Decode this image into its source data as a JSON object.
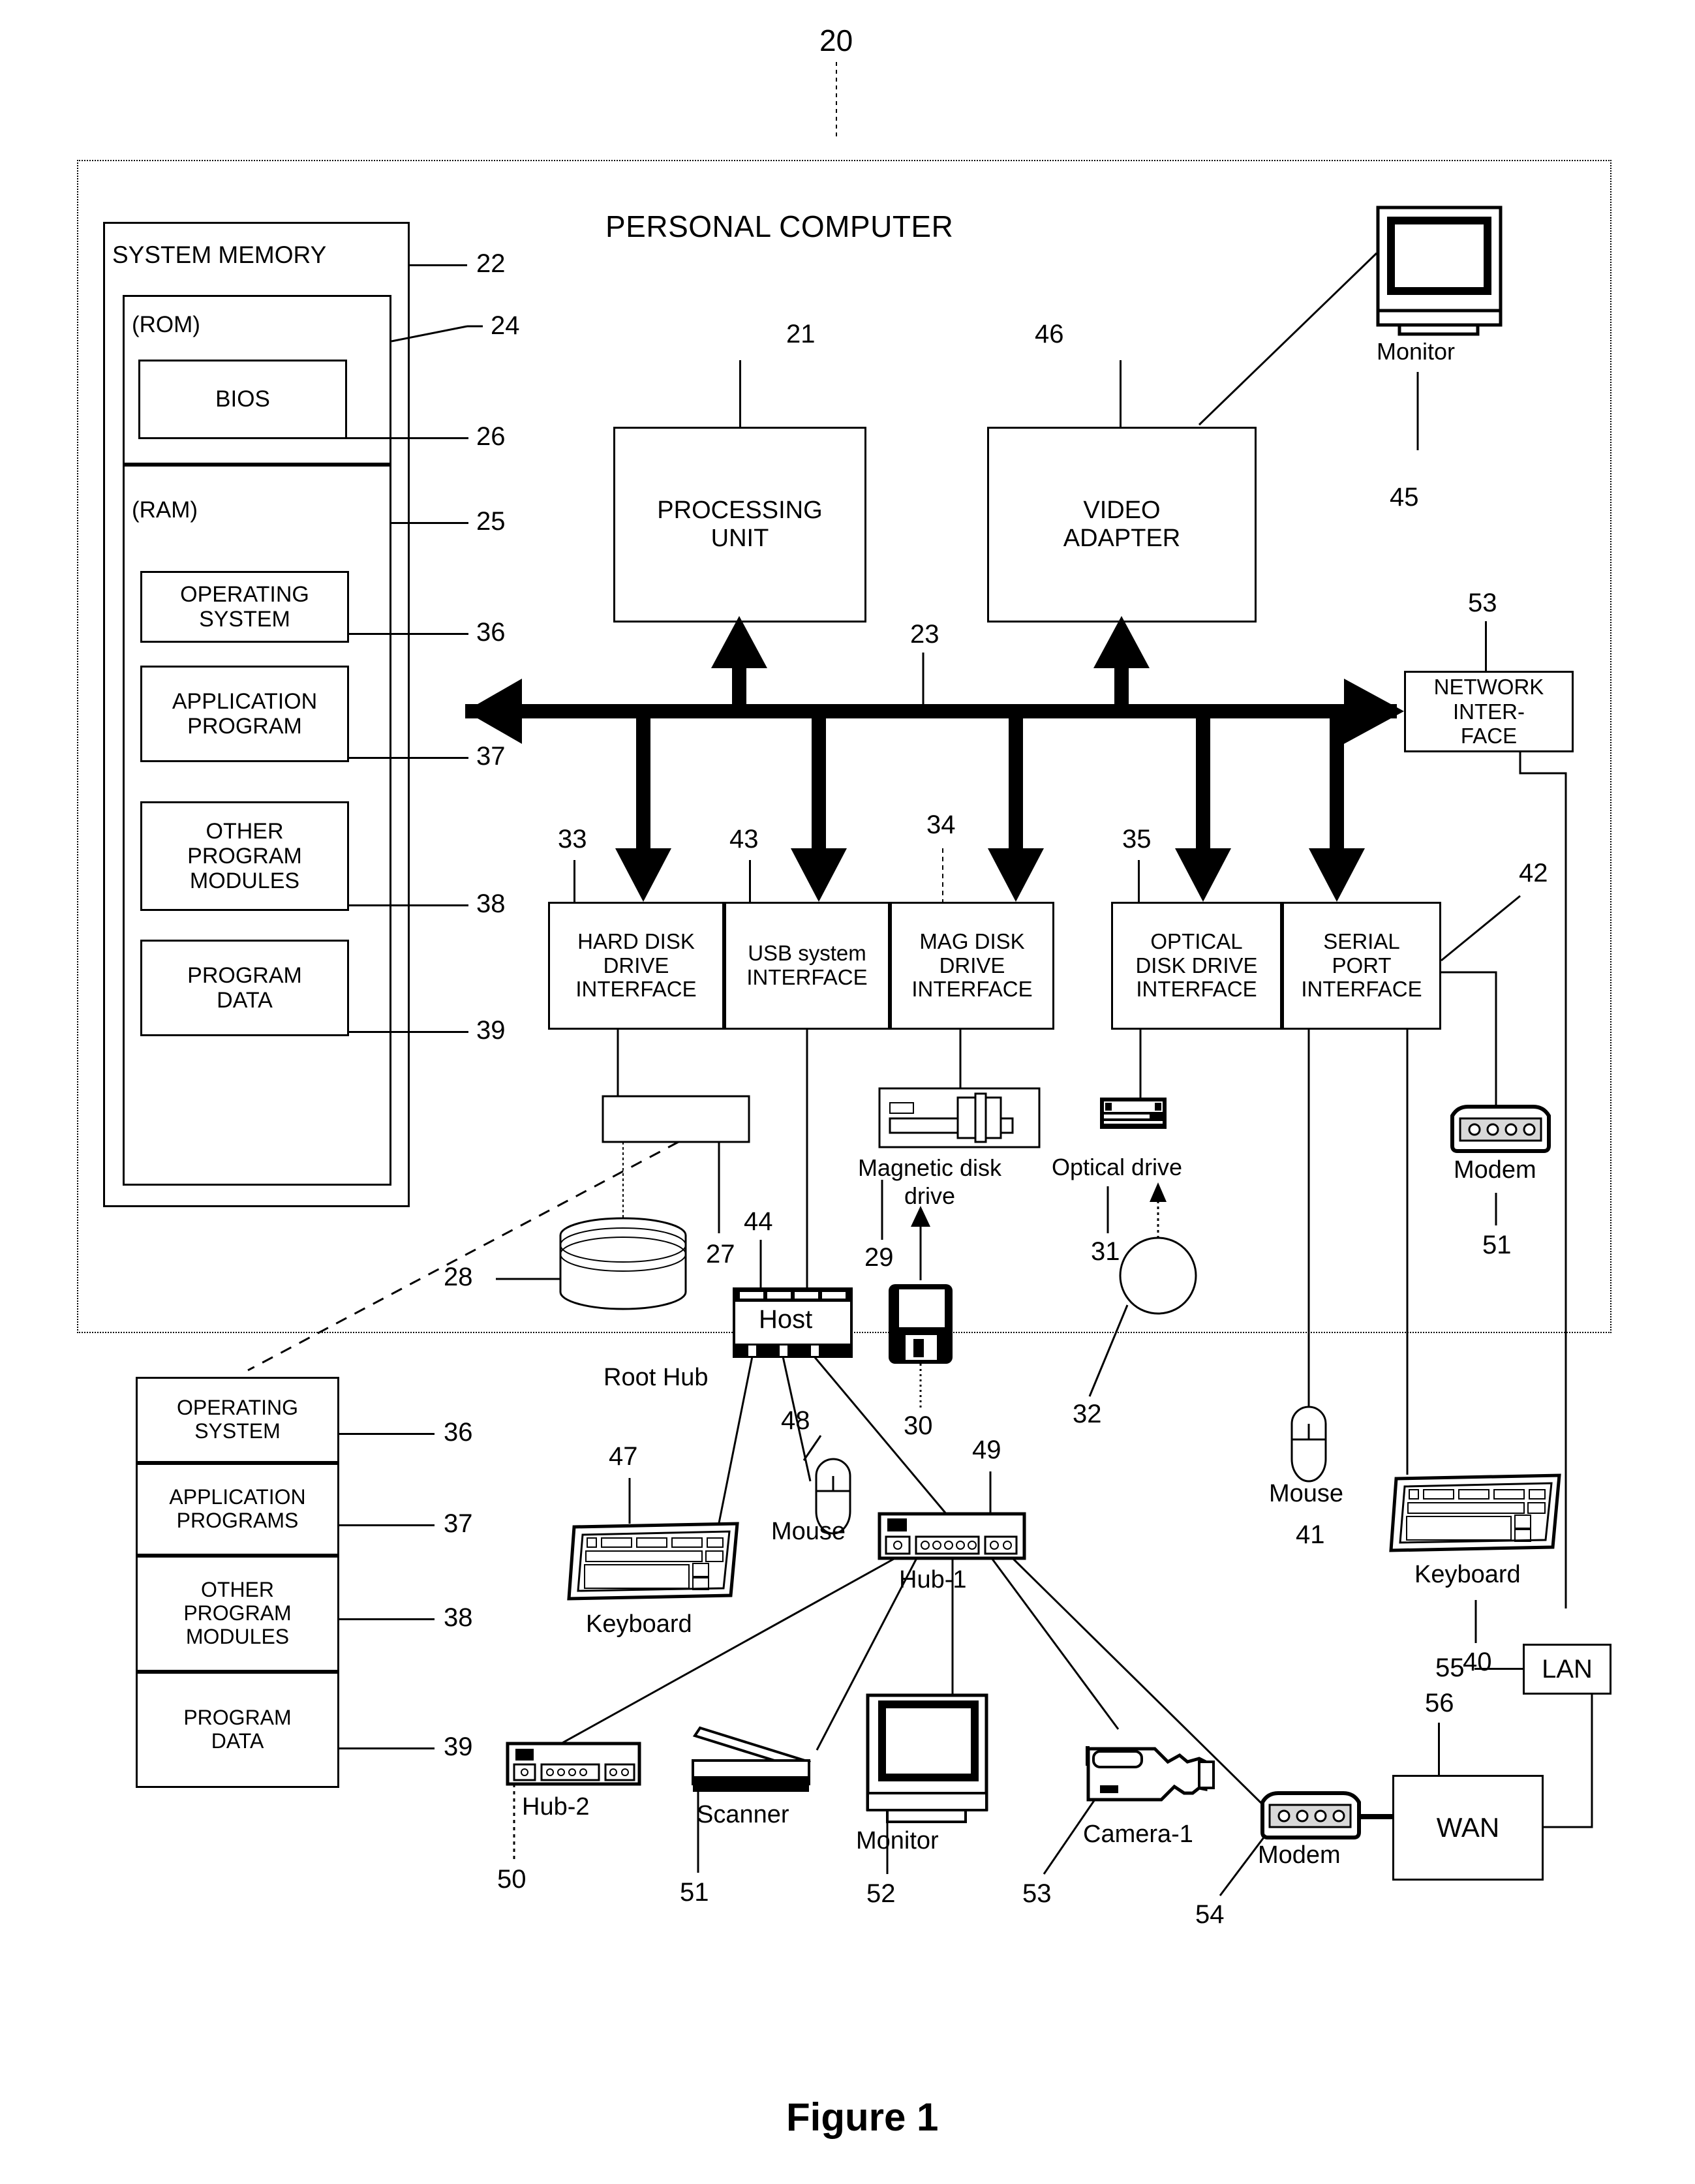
{
  "figure": {
    "caption": "Figure 1",
    "system_ref": "20",
    "title": "PERSONAL COMPUTER"
  },
  "system_memory": {
    "title": "SYSTEM MEMORY",
    "ref": "22",
    "rom": {
      "label": "(ROM)",
      "ref": "24"
    },
    "bios": {
      "label": "BIOS",
      "ref": "26"
    },
    "ram": {
      "label": "(RAM)",
      "ref": "25"
    },
    "items": [
      {
        "label": "OPERATING\nSYSTEM",
        "ref": "36"
      },
      {
        "label": "APPLICATION\nPROGRAM",
        "ref": "37"
      },
      {
        "label": "OTHER\nPROGRAM\nMODULES",
        "ref": "38"
      },
      {
        "label": "PROGRAM\nDATA",
        "ref": "39"
      }
    ]
  },
  "core": {
    "processing_unit": {
      "label": "PROCESSING\nUNIT",
      "ref": "21"
    },
    "video_adapter": {
      "label": "VIDEO\nADAPTER",
      "ref": "46"
    },
    "monitor": {
      "label": "Monitor",
      "ref": "45"
    },
    "network_interface": {
      "label": "NETWORK\nINTER-\nFACE",
      "ref": "53"
    },
    "system_bus": {
      "ref": "23"
    }
  },
  "interfaces": [
    {
      "label": "HARD DISK\nDRIVE\nINTERFACE",
      "ref": "33"
    },
    {
      "label": "USB system\nINTERFACE",
      "ref": "43"
    },
    {
      "label": "MAG DISK\nDRIVE\nINTERFACE",
      "ref": "34"
    },
    {
      "label": "OPTICAL\nDISK DRIVE\nINTERFACE",
      "ref": "35"
    },
    {
      "label": "SERIAL\nPORT\nINTERFACE",
      "ref": "42"
    }
  ],
  "drives": {
    "hard_disk_drive": {
      "ref": "27"
    },
    "hard_disk": {
      "ref": "28"
    },
    "magnetic_disk_drive": {
      "label": "Magnetic disk\ndrive",
      "ref": "29"
    },
    "magnetic_disk": {
      "ref": "30"
    },
    "optical_drive": {
      "label": "Optical drive",
      "ref": "31"
    },
    "optical_disk": {
      "ref": "32"
    }
  },
  "hard_disk_contents": [
    {
      "label": "OPERATING\nSYSTEM",
      "ref": "36"
    },
    {
      "label": "APPLICATION\nPROGRAMS",
      "ref": "37"
    },
    {
      "label": "OTHER\nPROGRAM\nMODULES",
      "ref": "38"
    },
    {
      "label": "PROGRAM\nDATA",
      "ref": "39"
    }
  ],
  "usb_tree": {
    "host": {
      "label": "Host",
      "ref": "44"
    },
    "root_hub": {
      "label": "Root Hub"
    },
    "keyboard": {
      "label": "Keyboard",
      "ref": "47"
    },
    "mouse": {
      "label": "Mouse",
      "ref": "48"
    },
    "hub1": {
      "label": "Hub-1",
      "ref": "49"
    },
    "hub2": {
      "label": "Hub-2",
      "ref": "50"
    },
    "scanner": {
      "label": "Scanner",
      "ref": "51"
    },
    "monitor": {
      "label": "Monitor",
      "ref": "52"
    },
    "camera1": {
      "label": "Camera-1",
      "ref": "53"
    },
    "modem_usb": {
      "label": "Modem",
      "ref": "54"
    }
  },
  "serial_devices": {
    "modem": {
      "label": "Modem",
      "ref": "51"
    },
    "keyboard": {
      "label": "Keyboard",
      "ref": "40"
    },
    "mouse": {
      "label": "Mouse",
      "ref": "41"
    }
  },
  "networks": {
    "lan": {
      "label": "LAN",
      "ref": "55"
    },
    "wan": {
      "label": "WAN",
      "ref": "56"
    }
  }
}
